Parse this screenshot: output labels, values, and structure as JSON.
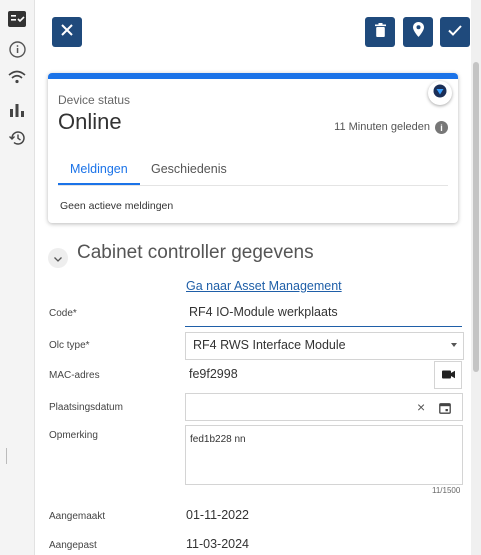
{
  "rail": {
    "icons": [
      "checklist-icon",
      "info-icon",
      "wifi-icon",
      "bar-chart-icon",
      "history-icon"
    ]
  },
  "toolbar": {
    "close_icon": "close-icon",
    "delete_icon": "trash-icon",
    "location_icon": "location-pin-icon",
    "confirm_icon": "check-icon"
  },
  "device_status": {
    "label": "Device status",
    "value": "Online",
    "last_seen": "11 Minuten geleden",
    "tabs": [
      "Meldingen",
      "Geschiedenis"
    ],
    "active_tab": "Meldingen",
    "empty_message": "Geen actieve meldingen"
  },
  "section": {
    "title": "Cabinet controller gegevens",
    "asset_link": "Ga naar Asset Management"
  },
  "form": {
    "code_label": "Code*",
    "code_value": "RF4 IO-Module werkplaats",
    "olc_label": "Olc type*",
    "olc_value": "RF4 RWS Interface Module",
    "mac_label": "MAC-adres",
    "mac_value": "fe9f2998",
    "date_label": "Plaatsingsdatum",
    "date_value": "",
    "remark_label": "Opmerking",
    "remark_value": "fed1b228 nn",
    "remark_counter": "11/1500",
    "created_label": "Aangemaakt",
    "created_value": "01-11-2022",
    "modified_label": "Aangepast",
    "modified_value": "11-03-2024"
  },
  "colors": {
    "primary": "#1f4a7c",
    "accent": "#1b73e8",
    "link": "#1f5fa8"
  }
}
